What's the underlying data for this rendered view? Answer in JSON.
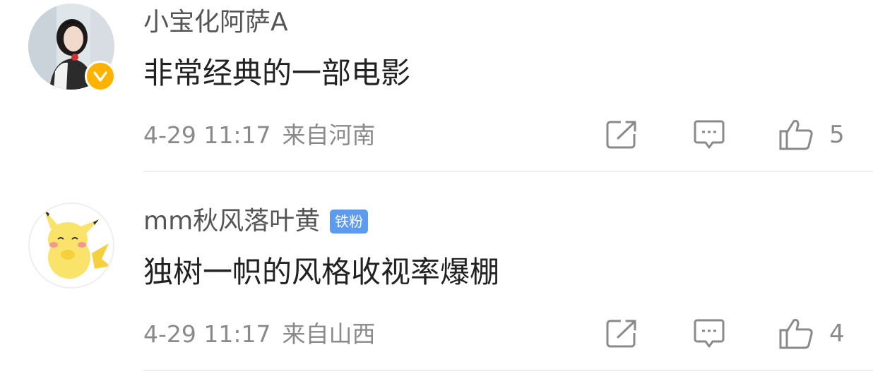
{
  "comments": [
    {
      "username": "小宝化阿萨A",
      "badge": "",
      "verified": true,
      "content": "非常经典的一部电影",
      "time": "4-29 11:17",
      "location": "来自河南",
      "likes": "5",
      "avatar_icon": "woman-portrait-avatar",
      "colors": {
        "verified_badge": "#ffb300"
      }
    },
    {
      "username": "mm秋风落叶黄",
      "badge": "铁粉",
      "verified": false,
      "content": "独树一帜的风格收视率爆棚",
      "time": "4-29 11:17",
      "location": "来自山西",
      "likes": "4",
      "avatar_icon": "pikachu-avatar",
      "colors": {
        "fan_badge": "#5c9bf0"
      }
    }
  ],
  "icons": {
    "share": "share-icon",
    "comment": "comment-icon",
    "like": "thumbs-up-icon"
  }
}
